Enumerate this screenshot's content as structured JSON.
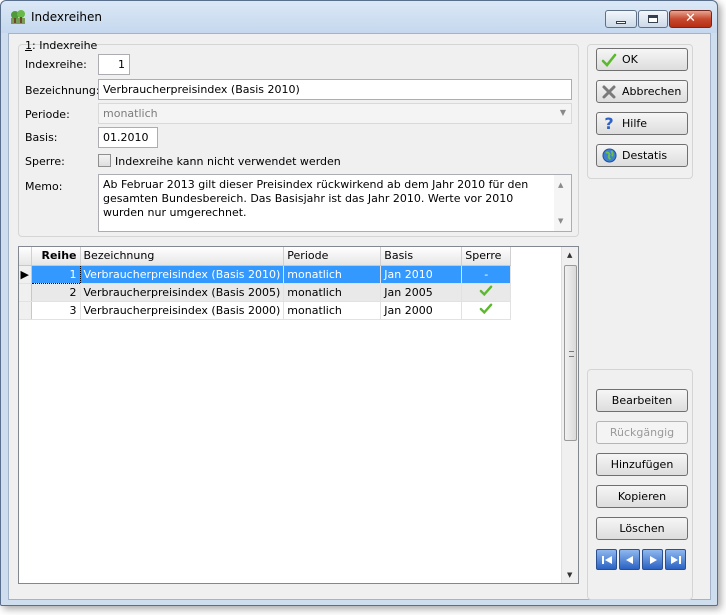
{
  "window": {
    "title": "Indexreihen"
  },
  "form": {
    "section_prefix": "1",
    "section_title": ": Indexreihe",
    "indexreihe_label": "Indexreihe:",
    "indexreihe_value": "1",
    "bezeichnung_label": "Bezeichnung:",
    "bezeichnung_value": "Verbraucherpreisindex (Basis 2010)",
    "periode_label": "Periode:",
    "periode_value": "monatlich",
    "basis_label": "Basis:",
    "basis_value": "01.2010",
    "sperre_label": "Sperre:",
    "sperre_checkbox_label": "Indexreihe kann nicht verwendet werden",
    "memo_label": "Memo:",
    "memo_value": "Ab Februar 2013 gilt dieser Preisindex rückwirkend ab dem Jahr 2010 für den gesamten Bundesbereich. Das Basisjahr ist das Jahr 2010. Werte vor 2010 wurden nur umgerechnet."
  },
  "buttons": {
    "ok": "OK",
    "abbrechen": "Abbrechen",
    "hilfe": "Hilfe",
    "destatis": "Destatis",
    "bearbeiten": "Bearbeiten",
    "rueckgaengig": "Rückgängig",
    "hinzufuegen": "Hinzufügen",
    "kopieren": "Kopieren",
    "loeschen": "Löschen"
  },
  "grid": {
    "columns": [
      "Reihe",
      "Bezeichnung",
      "Periode",
      "Basis",
      "Sperre"
    ],
    "rows": [
      {
        "reihe": "1",
        "bezeichnung": "Verbraucherpreisindex (Basis 2010)",
        "periode": "monatlich",
        "basis": "Jan 2010",
        "sperre": "-"
      },
      {
        "reihe": "2",
        "bezeichnung": "Verbraucherpreisindex (Basis 2005)",
        "periode": "monatlich",
        "basis": "Jan 2005",
        "sperre": "check"
      },
      {
        "reihe": "3",
        "bezeichnung": "Verbraucherpreisindex (Basis 2000)",
        "periode": "monatlich",
        "basis": "Jan 2000",
        "sperre": "check"
      }
    ]
  },
  "colors": {
    "selection": "#3399ff",
    "check": "#5cb82e",
    "nav": "#2b63c4"
  }
}
